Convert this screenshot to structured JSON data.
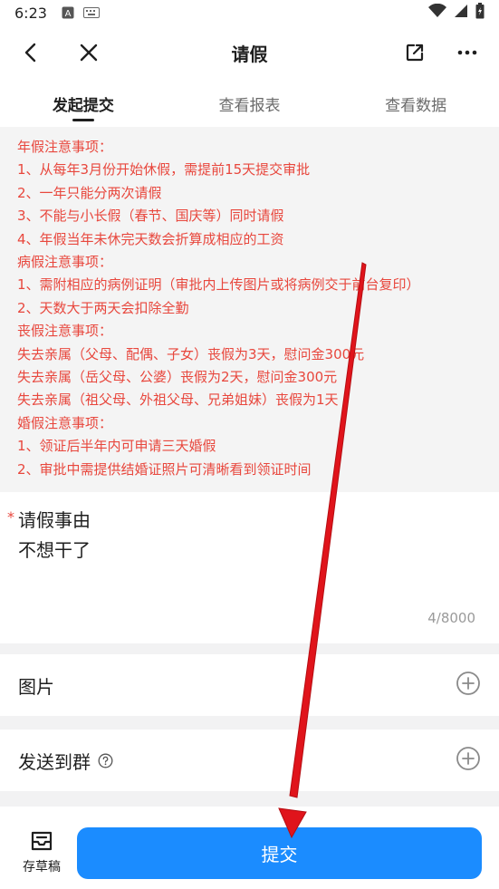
{
  "status_bar": {
    "time": "6:23"
  },
  "header": {
    "title": "请假"
  },
  "tabs": [
    {
      "label": "发起提交",
      "active": true
    },
    {
      "label": "查看报表",
      "active": false
    },
    {
      "label": "查看数据",
      "active": false
    }
  ],
  "notice": {
    "lines": [
      "年假注意事项：",
      "1、从每年3月份开始休假，需提前15天提交审批",
      "2、一年只能分两次请假",
      "3、不能与小长假（春节、国庆等）同时请假",
      "4、年假当年未休完天数会折算成相应的工资",
      "病假注意事项：",
      "1、需附相应的病例证明（审批内上传图片或将病例交于前台复印）",
      "2、天数大于两天会扣除全勤",
      "丧假注意事项：",
      "失去亲属（父母、配偶、子女）丧假为3天，慰问金300元",
      "失去亲属（岳父母、公婆）丧假为2天，慰问金300元",
      "失去亲属（祖父母、外祖父母、兄弟姐妹）丧假为1天",
      "婚假注意事项：",
      "1、领证后半年内可申请三天婚假",
      "2、审批中需提供结婚证照片可清晰看到领证时间"
    ],
    "color": "#e8473d"
  },
  "reason": {
    "required_mark": "*",
    "label": "请假事由",
    "value": "不想干了",
    "counter": "4/8000"
  },
  "images_row": {
    "label": "图片"
  },
  "group_row": {
    "label": "发送到群"
  },
  "bottom": {
    "draft_label": "存草稿",
    "submit_label": "提交",
    "accent": "#1b8cff"
  }
}
